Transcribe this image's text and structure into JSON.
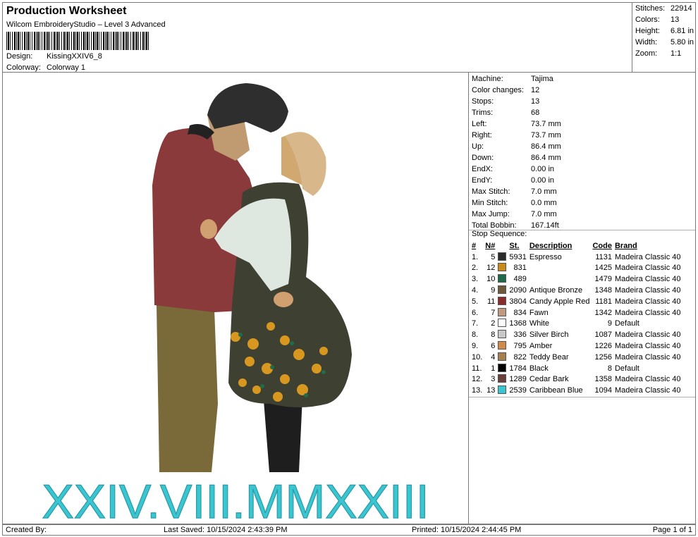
{
  "header": {
    "title": "Production Worksheet",
    "subtitle": "Wilcom EmbroideryStudio – Level 3 Advanced",
    "design_label": "Design:",
    "design_value": "KissingXXIV6_8",
    "colorway_label": "Colorway:",
    "colorway_value": "Colorway 1"
  },
  "summary": [
    {
      "label": "Stitches:",
      "value": "22914"
    },
    {
      "label": "Colors:",
      "value": "13"
    },
    {
      "label": "Height:",
      "value": "6.81 in"
    },
    {
      "label": "Width:",
      "value": "5.80 in"
    },
    {
      "label": "Zoom:",
      "value": "1:1"
    }
  ],
  "design": {
    "date_text": "XXIV.VIII.MMXXIII"
  },
  "machine_info": [
    {
      "label": "Machine:",
      "value": "Tajima"
    },
    {
      "label": "Color changes:",
      "value": "12"
    },
    {
      "label": "Stops:",
      "value": "13"
    },
    {
      "label": "Trims:",
      "value": "68"
    },
    {
      "label": "Left:",
      "value": "73.7 mm"
    },
    {
      "label": "Right:",
      "value": "73.7 mm"
    },
    {
      "label": "Up:",
      "value": "86.4 mm"
    },
    {
      "label": "Down:",
      "value": "86.4 mm"
    },
    {
      "label": "EndX:",
      "value": "0.00 in"
    },
    {
      "label": "EndY:",
      "value": "0.00 in"
    },
    {
      "label": "Max Stitch:",
      "value": "7.0 mm"
    },
    {
      "label": "Min Stitch:",
      "value": "0.0 mm"
    },
    {
      "label": "Max Jump:",
      "value": "7.0 mm"
    },
    {
      "label": "Total Bobbin:",
      "value": "167.14ft"
    }
  ],
  "stop_sequence": {
    "label": "Stop Sequence:",
    "headers": [
      "#",
      "N#",
      "St.",
      "Description",
      "Code",
      "Brand"
    ],
    "rows": [
      {
        "num": "1.",
        "n": "5",
        "st": "5931",
        "desc": "Espresso",
        "code": "1131",
        "brand": "Madeira Classic 40",
        "color": "#2b2b2b"
      },
      {
        "num": "2.",
        "n": "12",
        "st": "831",
        "desc": "",
        "code": "1425",
        "brand": "Madeira Classic 40",
        "color": "#c98a1a"
      },
      {
        "num": "3.",
        "n": "10",
        "st": "489",
        "desc": "",
        "code": "1479",
        "brand": "Madeira Classic 40",
        "color": "#1f6b4a"
      },
      {
        "num": "4.",
        "n": "9",
        "st": "2090",
        "desc": "Antique Bronze",
        "code": "1348",
        "brand": "Madeira Classic 40",
        "color": "#6e5a3a"
      },
      {
        "num": "5.",
        "n": "11",
        "st": "3804",
        "desc": "Candy Apple Red",
        "code": "1181",
        "brand": "Madeira Classic 40",
        "color": "#8a2a2a"
      },
      {
        "num": "6.",
        "n": "7",
        "st": "834",
        "desc": "Fawn",
        "code": "1342",
        "brand": "Madeira Classic 40",
        "color": "#c09a80"
      },
      {
        "num": "7.",
        "n": "2",
        "st": "1368",
        "desc": "White",
        "code": "9",
        "brand": "Default",
        "color": "#ffffff"
      },
      {
        "num": "8.",
        "n": "8",
        "st": "336",
        "desc": "Silver Birch",
        "code": "1087",
        "brand": "Madeira Classic 40",
        "color": "#c8c8c8"
      },
      {
        "num": "9.",
        "n": "6",
        "st": "795",
        "desc": "Amber",
        "code": "1226",
        "brand": "Madeira Classic 40",
        "color": "#d08a4a"
      },
      {
        "num": "10.",
        "n": "4",
        "st": "822",
        "desc": "Teddy Bear",
        "code": "1256",
        "brand": "Madeira Classic 40",
        "color": "#a88050"
      },
      {
        "num": "11.",
        "n": "1",
        "st": "1784",
        "desc": "Black",
        "code": "8",
        "brand": "Default",
        "color": "#000000"
      },
      {
        "num": "12.",
        "n": "3",
        "st": "1289",
        "desc": "Cedar Bark",
        "code": "1358",
        "brand": "Madeira Classic 40",
        "color": "#6a3e3a"
      },
      {
        "num": "13.",
        "n": "13",
        "st": "2539",
        "desc": "Caribbean Blue",
        "code": "1094",
        "brand": "Madeira Classic 40",
        "color": "#3ac6d0"
      }
    ]
  },
  "footer": {
    "created": "Created By:",
    "saved": "Last Saved: 10/15/2024 2:43:39 PM",
    "printed": "Printed: 10/15/2024 2:44:45 PM",
    "page": "Page 1 of 1"
  }
}
